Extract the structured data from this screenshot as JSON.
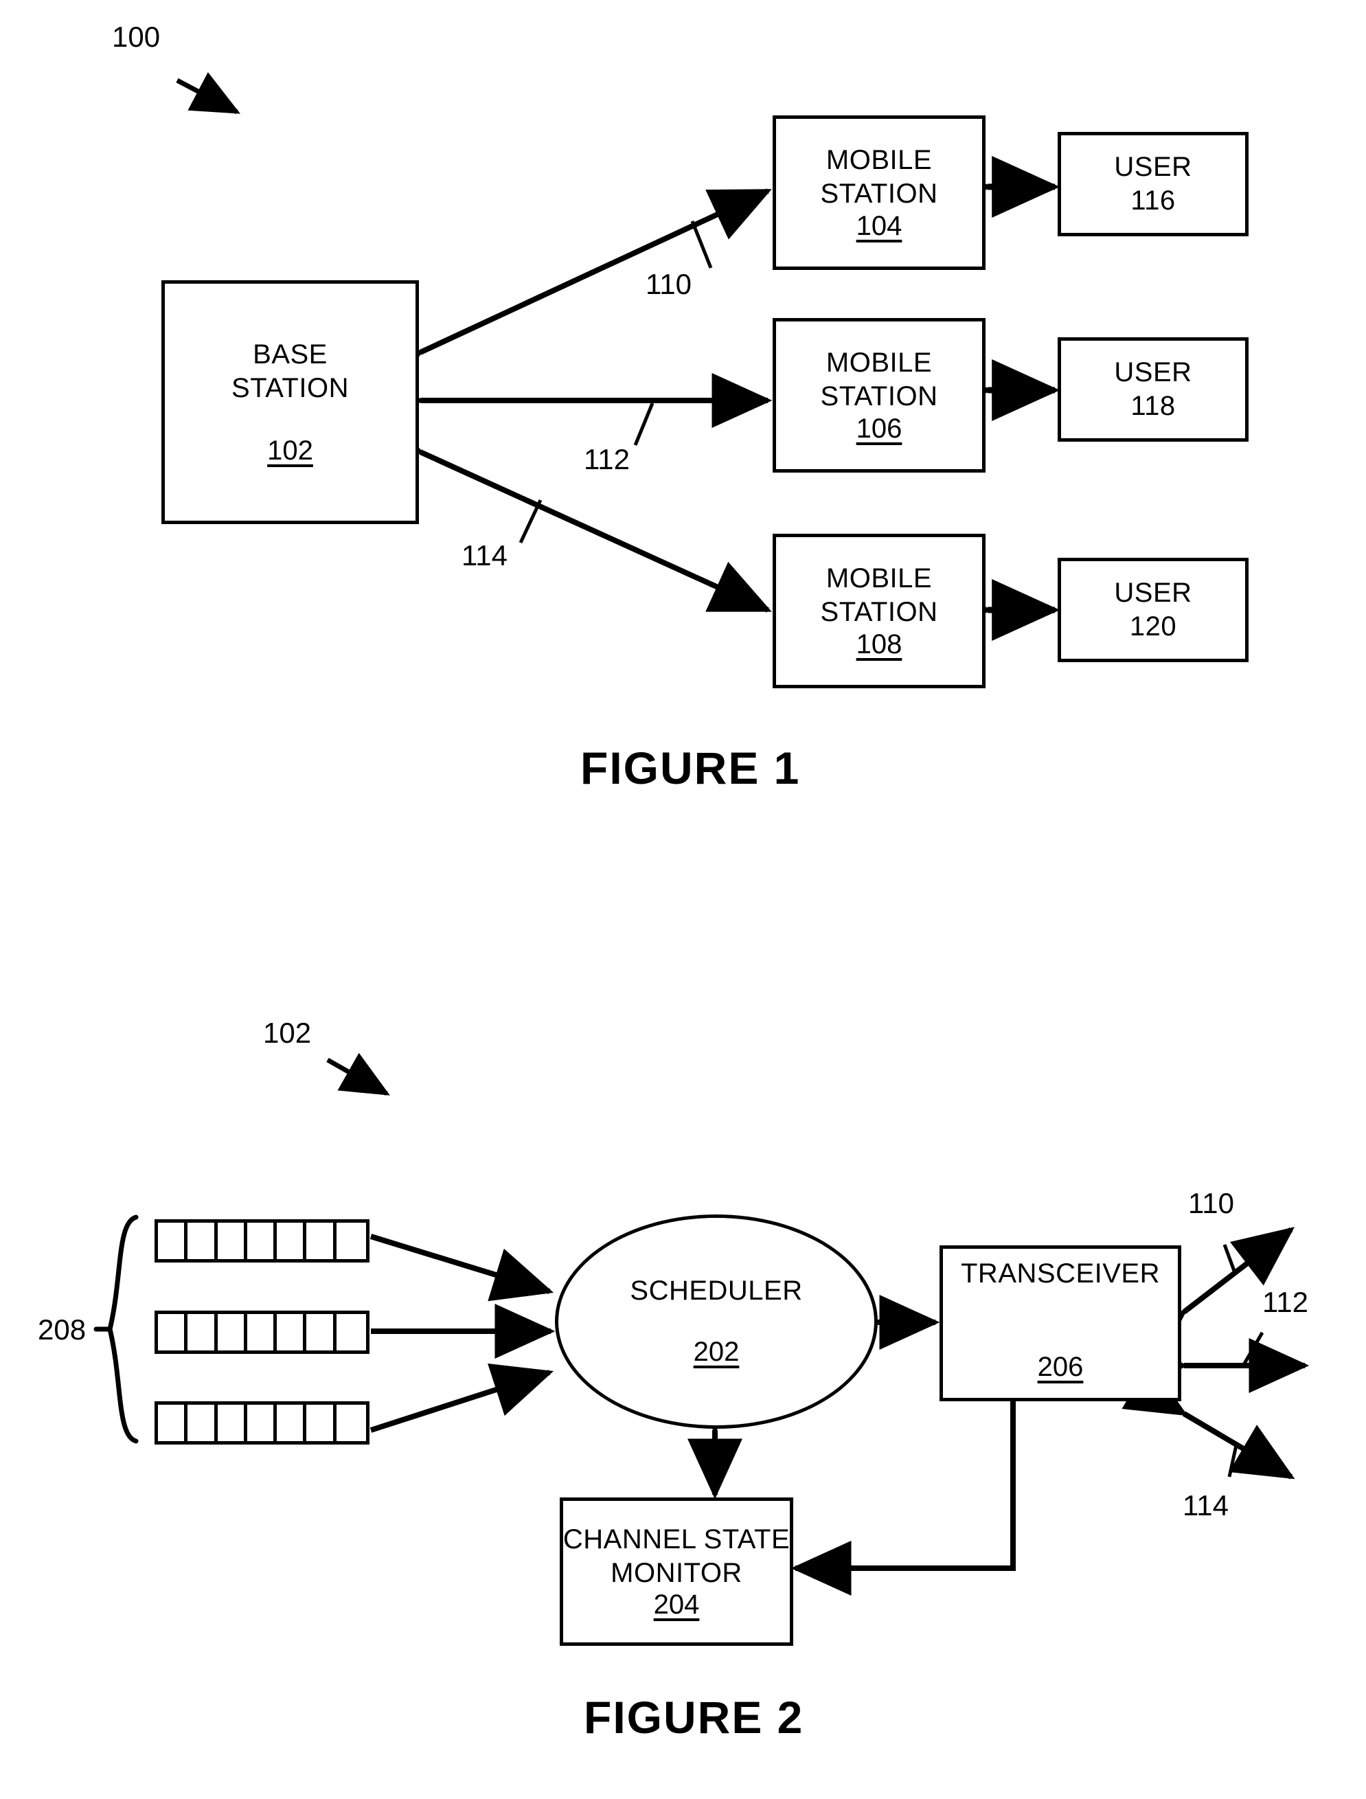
{
  "figure1": {
    "ref": "100",
    "caption": "FIGURE 1",
    "base_station": {
      "line1": "BASE",
      "line2": "STATION",
      "ref": "102"
    },
    "mobile_stations": [
      {
        "line1": "MOBILE",
        "line2": "STATION",
        "ref": "104"
      },
      {
        "line1": "MOBILE",
        "line2": "STATION",
        "ref": "106"
      },
      {
        "line1": "MOBILE",
        "line2": "STATION",
        "ref": "108"
      }
    ],
    "users": [
      {
        "line1": "USER",
        "ref": "116"
      },
      {
        "line1": "USER",
        "ref": "118"
      },
      {
        "line1": "USER",
        "ref": "120"
      }
    ],
    "links": [
      {
        "ref": "110"
      },
      {
        "ref": "112"
      },
      {
        "ref": "114"
      }
    ]
  },
  "figure2": {
    "ref": "102",
    "caption": "FIGURE 2",
    "queues": {
      "ref": "208",
      "count": 3,
      "cells_per_queue": 7
    },
    "scheduler": {
      "line1": "SCHEDULER",
      "ref": "202"
    },
    "transceiver": {
      "line1": "TRANSCEIVER",
      "ref": "206"
    },
    "channel_state_monitor": {
      "line1": "CHANNEL STATE",
      "line2": "MONITOR",
      "ref": "204"
    },
    "links": [
      {
        "ref": "110"
      },
      {
        "ref": "112"
      },
      {
        "ref": "114"
      }
    ]
  },
  "style": {
    "ink": "#000000",
    "paper": "#ffffff"
  }
}
